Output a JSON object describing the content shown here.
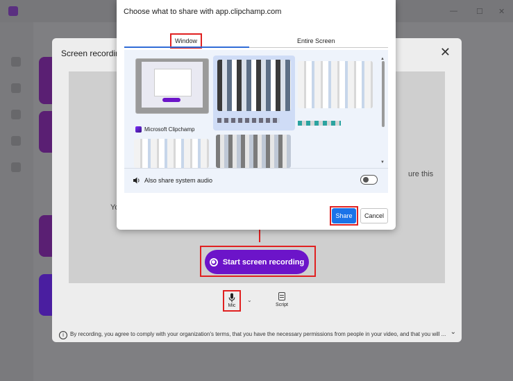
{
  "background": {
    "window_controls": [
      "—",
      "☐",
      "✕"
    ]
  },
  "modal": {
    "title": "Screen recording",
    "preview_text_left": "You'll p",
    "preview_text_right": "ure this",
    "start_button": "Start screen recording",
    "mic_label": "Mic",
    "script_label": "Script",
    "footer": "By recording, you agree to comply with your organization's terms, that you have the necessary permissions from people in your video, and that you will ...",
    "close_icon": "✕",
    "chevron_down_icon": "⌄",
    "info_icon": "i",
    "double_chevron_icon": "⌄"
  },
  "share_dialog": {
    "title": "Choose what to share with app.clipchamp.com",
    "tabs": [
      "Window",
      "Entire Screen"
    ],
    "selected_tab": "Window",
    "tiles": [
      {
        "label": "Microsoft Clipchamp",
        "selected": false
      },
      {
        "label": "",
        "selected": true
      },
      {
        "label": "",
        "selected": false
      },
      {
        "label": "",
        "selected": false
      },
      {
        "label": "",
        "selected": false
      }
    ],
    "audio_label": "Also share system audio",
    "audio_enabled": false,
    "share_button": "Share",
    "cancel_button": "Cancel"
  },
  "colors": {
    "accent_purple": "#6c14c9",
    "share_blue": "#1a73e8",
    "highlight_red": "#e02020"
  }
}
